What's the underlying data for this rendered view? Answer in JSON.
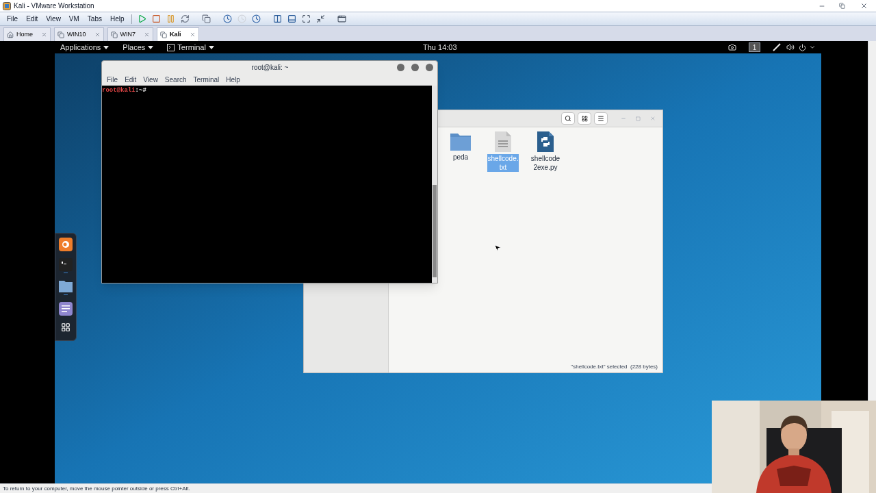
{
  "window": {
    "title": "Kali - VMware Workstation"
  },
  "menu": [
    "File",
    "Edit",
    "View",
    "VM",
    "Tabs",
    "Help"
  ],
  "tabs": [
    {
      "label": "Home",
      "kind": "home",
      "selected": false
    },
    {
      "label": "WIN10",
      "kind": "vm",
      "selected": false
    },
    {
      "label": "WIN7",
      "kind": "vm",
      "selected": false
    },
    {
      "label": "Kali",
      "kind": "vm",
      "selected": true
    }
  ],
  "guest": {
    "top_bar": {
      "menus": [
        "Applications",
        "Places",
        "Terminal"
      ],
      "clock": "Thu 14:03",
      "workspace": "1"
    },
    "terminal": {
      "title": "root@kali: ~",
      "menu": [
        "File",
        "Edit",
        "View",
        "Search",
        "Terminal",
        "Help"
      ],
      "prompt_user": "root@kali",
      "prompt_path": ":~#"
    },
    "files": {
      "items": [
        {
          "name": "peda",
          "kind": "folder",
          "selected": false
        },
        {
          "name": "shellcode.txt",
          "kind": "text",
          "selected": true
        },
        {
          "name": "shellcode2exe.py",
          "kind": "python",
          "selected": false
        }
      ],
      "status": "\"shellcode.txt\" selected  (228 bytes)"
    }
  },
  "status_bar": "To return to your computer, move the mouse pointer outside or press Ctrl+Alt."
}
